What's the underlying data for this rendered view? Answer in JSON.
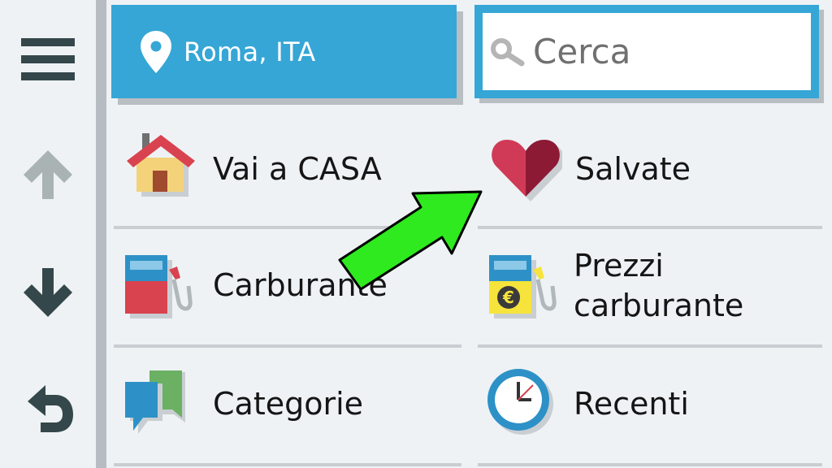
{
  "location": {
    "label": "Roma, ITA",
    "icon": "map-pin-icon"
  },
  "search": {
    "placeholder": "Cerca",
    "icon": "search-icon"
  },
  "sidebar": {
    "items": [
      {
        "name": "menu",
        "icon": "hamburger-menu-icon"
      },
      {
        "name": "scroll-up",
        "icon": "arrow-up-icon"
      },
      {
        "name": "scroll-down",
        "icon": "arrow-down-icon"
      },
      {
        "name": "back",
        "icon": "back-arrow-icon"
      }
    ]
  },
  "menu": {
    "home": {
      "label": "Vai a CASA",
      "icon": "house-icon"
    },
    "saved": {
      "label": "Salvate",
      "icon": "heart-icon"
    },
    "fuel": {
      "label": "Carburante",
      "icon": "fuel-pump-icon"
    },
    "fuel_prices": {
      "label_line1": "Prezzi",
      "label_line2": "carburante",
      "icon": "fuel-price-euro-icon"
    },
    "categories": {
      "label": "Categorie",
      "icon": "speech-bubbles-icon"
    },
    "recent": {
      "label": "Recenti",
      "icon": "clock-icon"
    }
  },
  "annotation": {
    "icon": "green-arrow-icon",
    "color": "#2eea1e"
  },
  "colors": {
    "accent": "#36a6d6",
    "background": "#eef2f5"
  }
}
